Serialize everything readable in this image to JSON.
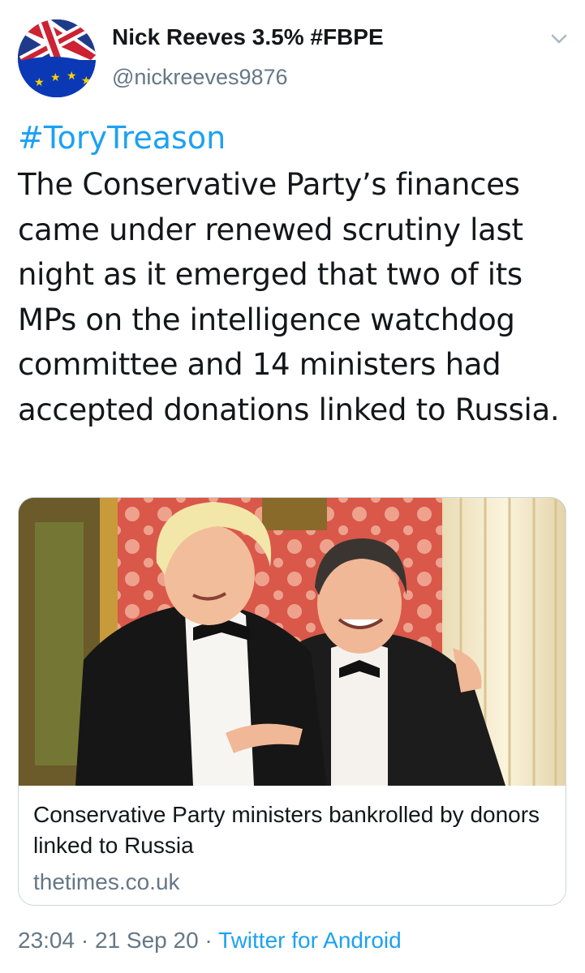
{
  "author": {
    "display_name": "Nick Reeves 3.5% #FBPE",
    "handle": "@nickreeves9876",
    "avatar_icon": "eu-union-flag-avatar"
  },
  "tweet": {
    "hashtag": "#ToryTreason",
    "text": "The Conservative Party’s finances came under renewed scrutiny last night as it emerged that two of its MPs on the intelligence watchdog committee and 14 ministers had accepted donations linked to Russia."
  },
  "card": {
    "title": "Conservative Party ministers bankrolled by donors linked to Russia",
    "domain": "thetimes.co.uk",
    "image_icon": "photo-two-men-in-tuxedos"
  },
  "meta": {
    "time": "23:04",
    "separator": " · ",
    "date": "21 Sep 20",
    "source": "Twitter for Android"
  },
  "colors": {
    "link": "#1da1f2",
    "secondary_text": "#657786",
    "primary_text": "#14171a",
    "border": "#ccd6dd"
  }
}
